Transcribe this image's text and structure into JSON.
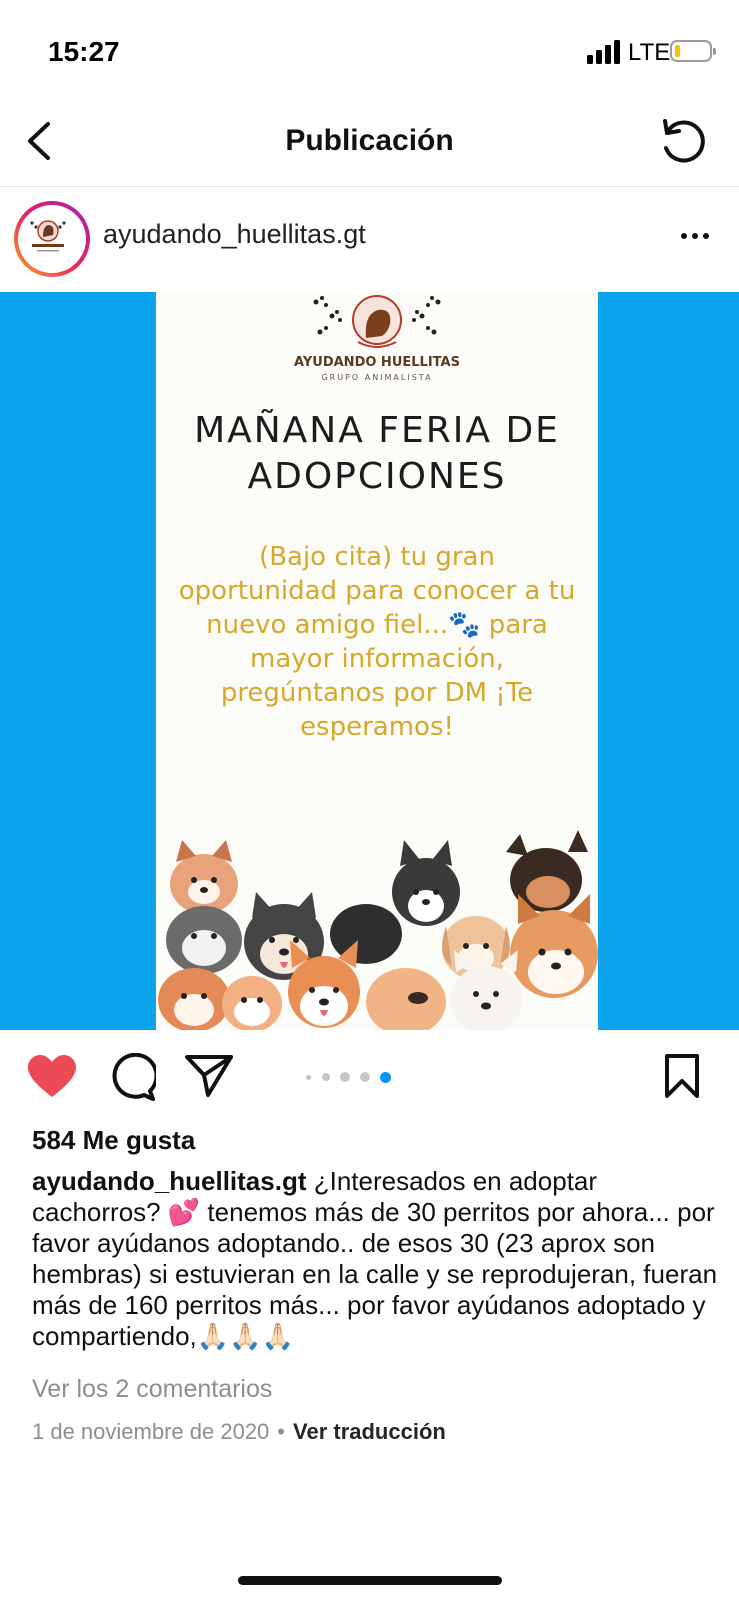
{
  "status_bar": {
    "time": "15:27",
    "network": "LTE"
  },
  "nav": {
    "title": "Publicación",
    "back_icon": "chevron-left-icon",
    "refresh_icon": "refresh-icon"
  },
  "post": {
    "username": "ayudando_huellitas.gt",
    "more_icon": "more-horizontal-icon",
    "image": {
      "background_color": "#0ba3ec",
      "brand_name": "AYUDANDO HUELLITAS",
      "brand_sub": "GRUPO ANIMALISTA",
      "headline_line1": "MAÑANA FERIA DE",
      "headline_line2": "ADOPCIONES",
      "body_text": "(Bajo cita) tu gran oportunidad para conocer a tu nuevo amigo fiel...🐾 para mayor información, pregúntanos por DM ¡Te esperamos!",
      "body_text_color": "#d5a92b",
      "carousel": {
        "total": 5,
        "current": 5
      }
    },
    "actions": {
      "like_icon": "heart-filled-icon",
      "comment_icon": "comment-icon",
      "share_icon": "send-icon",
      "save_icon": "bookmark-icon",
      "like_color": "#ed4956"
    },
    "likes": "584 Me gusta",
    "caption_user": "ayudando_huellitas.gt",
    "caption_text": "¿Interesados en adoptar cachorros? 💕 tenemos más de 30 perritos por ahora... por favor ayúdanos adoptando.. de esos 30 (23 aprox son hembras) si estuvieran en la calle y se reprodujeran, fueran más de 160 perritos más... por favor ayúdanos adoptado y compartiendo,🙏🏻🙏🏻🙏🏻",
    "comments_link": "Ver los 2 comentarios",
    "date": "1 de noviembre de 2020",
    "separator": "•",
    "translate_link": "Ver traducción"
  }
}
